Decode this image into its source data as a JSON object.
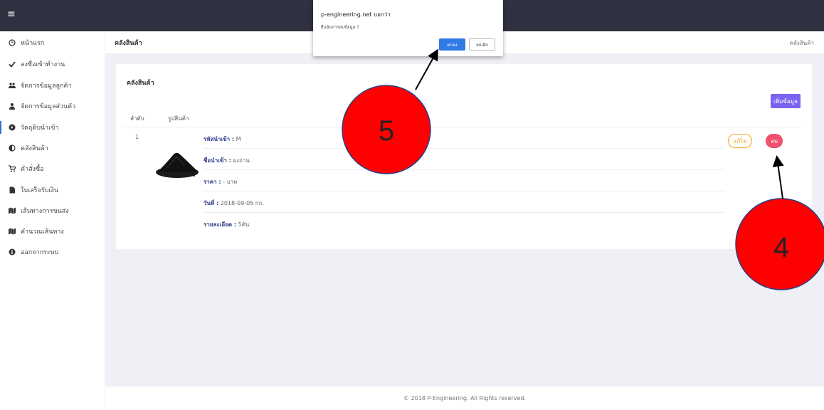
{
  "topbar": {
    "menu_icon": "≡"
  },
  "sidebar": {
    "items": [
      {
        "label": "หน้าแรก",
        "icon": "clock-icon"
      },
      {
        "label": "ลงชื่อเข้าทำงาน",
        "icon": "check-icon"
      },
      {
        "label": "จัดการข้อมูลลูกค้า",
        "icon": "users-icon"
      },
      {
        "label": "จัดการข้อมูลส่วนตัว",
        "icon": "user-icon"
      },
      {
        "label": "วัตถุดิบนำเข้า",
        "icon": "circle-arrow-icon",
        "active": true
      },
      {
        "label": "คลังสินค้า",
        "icon": "half-circle-icon"
      },
      {
        "label": "คำสั่งซื้อ",
        "icon": "cart-icon"
      },
      {
        "label": "ใบเสร็จรับเงิน",
        "icon": "file-icon"
      },
      {
        "label": "เส้นทางการขนส่ง",
        "icon": "map-icon"
      },
      {
        "label": "คำนวณเส้นทาง",
        "icon": "map-icon"
      },
      {
        "label": "ออกจากระบบ",
        "icon": "info-icon"
      }
    ]
  },
  "header": {
    "title": "คลังสินค้า",
    "breadcrumb": "คลังสินค้า"
  },
  "card": {
    "title": "คลังสินค้า",
    "add_label": "เพิ่มข้อมูล",
    "columns": [
      "ลำดับ",
      "รูปสินค้า"
    ],
    "row": {
      "index": "1",
      "details": [
        {
          "label": "รหัสนำเข้า :",
          "value": "M"
        },
        {
          "label": "ชื่อนำเข้า :",
          "value": "ผงถ่าน"
        },
        {
          "label": "ราคา :",
          "value": "- บาท"
        },
        {
          "label": "วันที่ :",
          "value": "2018-09-05 กก."
        },
        {
          "label": "รายละเอียด :",
          "value": "5ตัน"
        }
      ],
      "edit_label": "แก้ไข",
      "delete_label": "ลบ"
    }
  },
  "footer": {
    "text": "© 2018 P-Engineering. All Rights reserved."
  },
  "dialog": {
    "title": "p-engineering.net บอกว่า",
    "message": "ยืนยันการลบข้อมูล ?",
    "ok_label": "ตกลง",
    "cancel_label": "ยกเลิก"
  },
  "annotations": [
    {
      "label": "5",
      "color": "#ff0000"
    },
    {
      "label": "4",
      "color": "#ff0000"
    }
  ]
}
